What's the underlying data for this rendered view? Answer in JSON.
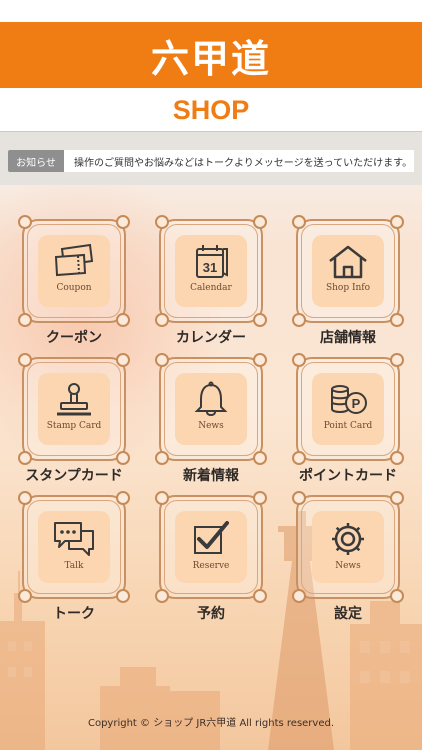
{
  "brand": {
    "title": "六甲道",
    "subtitle": "SHOP"
  },
  "notice": {
    "badge": "お知らせ",
    "message": "操作のご質問やお悩みなどはトークよりメッセージを送っていただけます。"
  },
  "menu": [
    {
      "en": "Coupon",
      "jp": "クーポン",
      "icon": "ticket-icon"
    },
    {
      "en": "Calendar",
      "jp": "カレンダー",
      "icon": "calendar-icon",
      "icon_text": "31"
    },
    {
      "en": "Shop Info",
      "jp": "店舗情報",
      "icon": "house-icon"
    },
    {
      "en": "Stamp Card",
      "jp": "スタンプカード",
      "icon": "stamp-icon"
    },
    {
      "en": "News",
      "jp": "新着情報",
      "icon": "bell-icon"
    },
    {
      "en": "Point Card",
      "jp": "ポイントカード",
      "icon": "coins-icon",
      "icon_text": "P"
    },
    {
      "en": "Talk",
      "jp": "トーク",
      "icon": "chat-bubbles-icon"
    },
    {
      "en": "Reserve",
      "jp": "予約",
      "icon": "checkbox-icon"
    },
    {
      "en": "News",
      "jp": "設定",
      "icon": "gear-icon"
    }
  ],
  "footer": {
    "copyright": "Copyright © ショップ JR六甲道 All rights reserved."
  },
  "colors": {
    "brand_orange": "#ef7d14",
    "tile_fill": "#fcd6b1",
    "frame": "#c79164"
  }
}
